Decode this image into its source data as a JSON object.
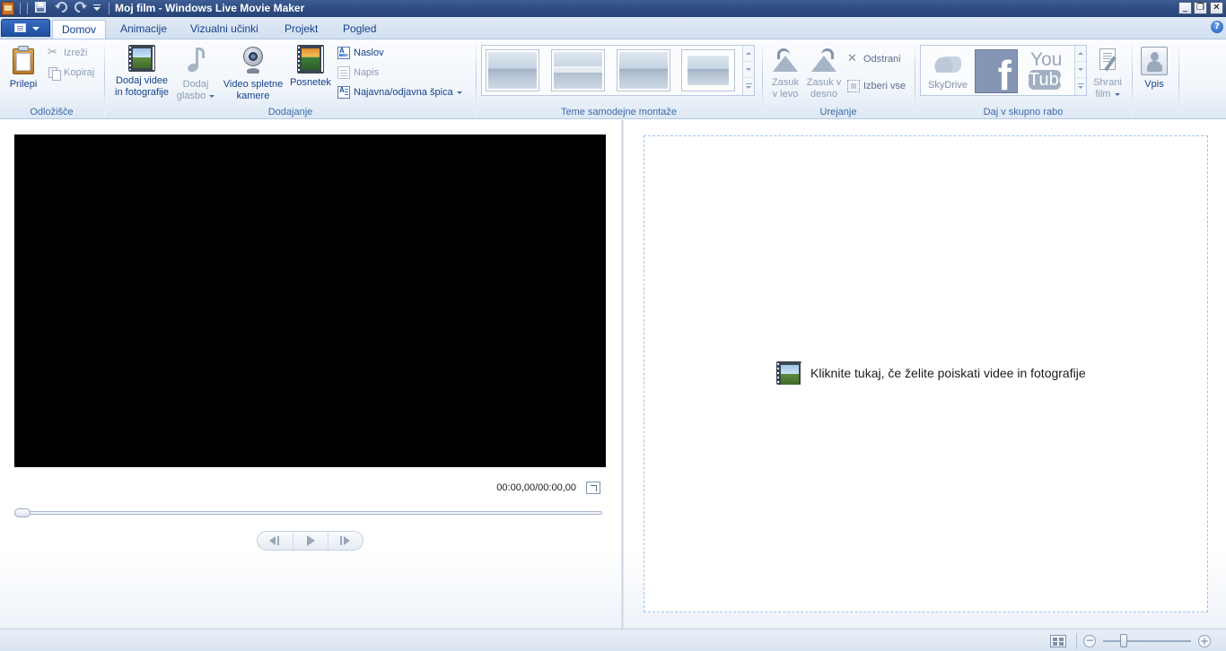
{
  "window": {
    "title": "Moj film - Windows Live Movie Maker",
    "minimize_label": "_",
    "restore_label": "❐",
    "close_label": "✕"
  },
  "qat": {
    "save_icon": "save-icon",
    "undo_icon": "undo-icon",
    "redo_icon": "redo-icon",
    "customize_icon": "customize-qat-icon"
  },
  "tabs": [
    {
      "label": "Domov",
      "active": true
    },
    {
      "label": "Animacije"
    },
    {
      "label": "Vizualni učinki"
    },
    {
      "label": "Projekt"
    },
    {
      "label": "Pogled"
    }
  ],
  "help_glyph": "?",
  "ribbon": {
    "clipboard": {
      "label": "Odložišče",
      "paste": "Prilepi",
      "cut": "Izreži",
      "copy": "Kopiraj"
    },
    "add": {
      "label": "Dodajanje",
      "add_videos_line1": "Dodaj videe",
      "add_videos_line2": "in fotografije",
      "add_music_line1": "Dodaj",
      "add_music_line2": "glasbo",
      "webcam_line1": "Video spletne",
      "webcam_line2": "kamere",
      "snapshot": "Posnetek",
      "title": "Naslov",
      "caption": "Napis",
      "credits": "Najavna/odjavna špica"
    },
    "themes": {
      "label": "Teme samodejne montaže",
      "items": [
        "theme-1",
        "theme-2",
        "theme-3",
        "theme-4"
      ]
    },
    "editing": {
      "label": "Urejanje",
      "rotate_left_line1": "Zasuk",
      "rotate_left_line2": "v levo",
      "rotate_right_line1": "Zasuk v",
      "rotate_right_line2": "desno",
      "remove": "Odstrani",
      "select_all": "Izberi vse"
    },
    "share": {
      "label": "Daj v skupno rabo",
      "skydrive": "SkyDrive",
      "facebook": "f",
      "youtube_top": "You",
      "youtube_bottom": "Tube",
      "save_movie_line1": "Shrani",
      "save_movie_line2": "film"
    },
    "signin": {
      "label": "Vpis"
    }
  },
  "preview": {
    "timecode": "00:00,00/00:00,00",
    "playback_position": 0
  },
  "storyboard": {
    "hint": "Kliknite tukaj, če želite poiskati videe in fotografije"
  },
  "statusbar": {
    "zoom_out": "−",
    "zoom_in": "+"
  }
}
